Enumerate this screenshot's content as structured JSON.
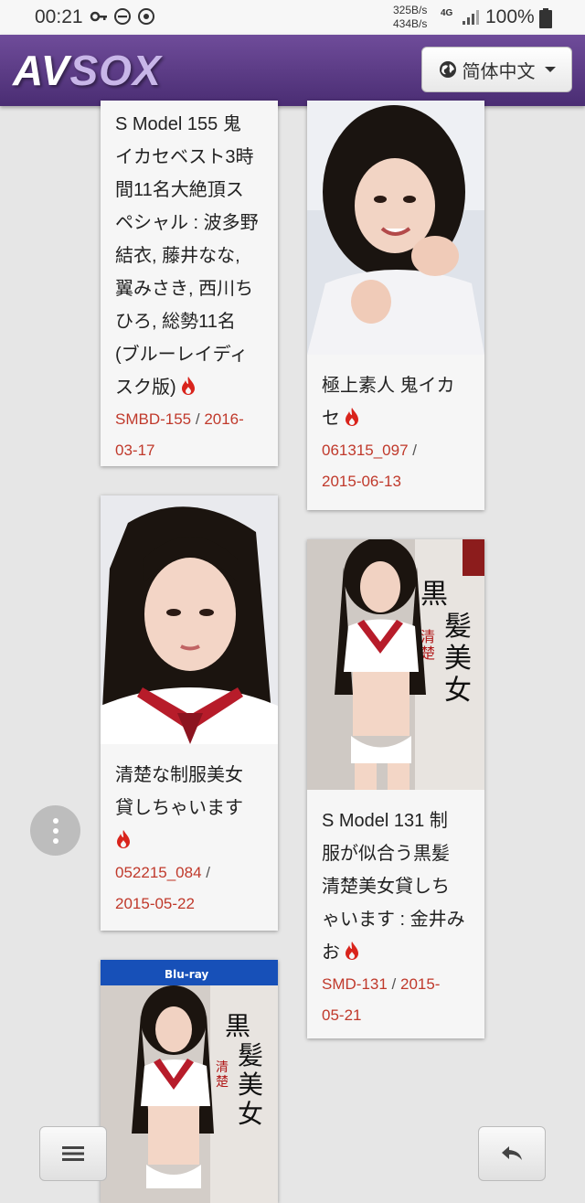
{
  "status_bar": {
    "time": "00:21",
    "speed_up": "325B/s",
    "speed_down": "434B/s",
    "network": "4G",
    "battery": "100%"
  },
  "header": {
    "logo_part1": "AV",
    "logo_part2": "SOX",
    "language": "简体中文"
  },
  "cards": [
    {
      "title": "S Model 155 鬼イカセベスト3時間11名大絶頂スペシャル : 波多野結衣, 藤井なな, 翼みさき, 西川ちひろ, 総勢11名 (ブルーレイディスク版)",
      "title_lines": [
        "S Model 155 鬼",
        "イカセベスト3時",
        "間11名大絶頂ス",
        "ペシャル : 波多野",
        "結衣, 藤井なな,",
        "翼みさき, 西川ち",
        "ひろ, 総勢11名",
        "(ブルーレイディ",
        "スク版)"
      ],
      "code": "SMBD-155",
      "date": "2016-03-17",
      "date_lines": [
        "2016-",
        "03-17"
      ]
    },
    {
      "title": "極上素人 鬼イカセ",
      "title_lines": [
        "極上素人 鬼イカ",
        "セ"
      ],
      "code": "061315_097",
      "date": "2015-06-13"
    },
    {
      "title": "清楚な制服美女貸しちゃいます",
      "title_lines": [
        "清楚な制服美女",
        "貸しちゃいます"
      ],
      "code": "052215_084",
      "date": "2015-05-22"
    },
    {
      "title": "S Model 131 制服が似合う黒髪清楚美女貸しちゃいます : 金井みお",
      "title_lines": [
        "S Model 131 制",
        "服が似合う黒髪",
        "清楚美女貸しち",
        "ゃいます : 金井み",
        "お"
      ],
      "code": "SMD-131",
      "date": "2015-05-21",
      "date_lines": [
        "2015-",
        "05-21"
      ]
    }
  ],
  "colors": {
    "header_top": "#6f4c9a",
    "header_bottom": "#4a2d73",
    "link_red": "#c0392b",
    "background": "#e6e6e6"
  },
  "icons": [
    "key-icon",
    "dnd-icon",
    "sync-icon",
    "signal-icon",
    "battery-icon",
    "globe-icon",
    "fire-icon",
    "more-vertical-icon",
    "menu-icon",
    "back-icon"
  ]
}
